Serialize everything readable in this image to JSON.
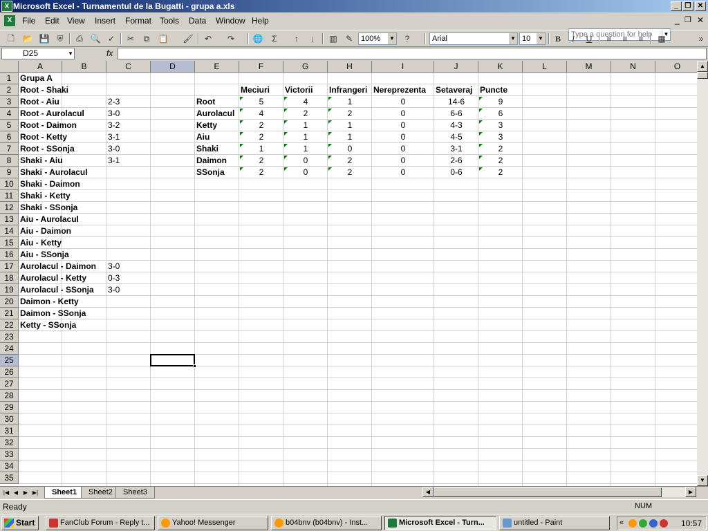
{
  "window": {
    "title": "Microsoft Excel - Turnamentul de la Bugatti - grupa a.xls"
  },
  "menu": [
    "File",
    "Edit",
    "View",
    "Insert",
    "Format",
    "Tools",
    "Data",
    "Window",
    "Help"
  ],
  "help_placeholder": "Type a question for help",
  "toolbar": {
    "zoom": "100%",
    "font": "Arial",
    "size": "10"
  },
  "name_box": "D25",
  "fx_symbol": "fx",
  "columns": [
    "A",
    "B",
    "C",
    "D",
    "E",
    "F",
    "G",
    "H",
    "I",
    "J",
    "K",
    "L",
    "M",
    "N",
    "O"
  ],
  "rows": [
    "1",
    "2",
    "3",
    "4",
    "5",
    "6",
    "7",
    "8",
    "9",
    "10",
    "11",
    "12",
    "13",
    "14",
    "15",
    "16",
    "17",
    "18",
    "19",
    "20",
    "21",
    "22",
    "23",
    "24",
    "25",
    "26",
    "27",
    "28",
    "29",
    "30",
    "31",
    "32",
    "33",
    "34",
    "35"
  ],
  "matches": [
    "Grupa A",
    "Root - Shaki",
    "Root - Aiu",
    "Root - Aurolacul",
    "Root - Daimon",
    "Root - Ketty",
    "Root - SSonja",
    "Shaki - Aiu",
    "Shaki - Aurolacul",
    "Shaki - Daimon",
    "Shaki - Ketty",
    "Shaki - SSonja",
    "Aiu - Aurolacul",
    "Aiu - Daimon",
    "Aiu - Ketty",
    "Aiu - SSonja",
    "Aurolacul - Daimon",
    "Aurolacul - Ketty",
    "Aurolacul - SSonja",
    "Daimon - Ketty",
    "Daimon - SSonja",
    "Ketty - SSonja"
  ],
  "scores": [
    "",
    "",
    "2-3",
    "3-0",
    "3-2",
    "3-1",
    "3-0",
    "3-1",
    "",
    "",
    "",
    "",
    "",
    "",
    "",
    "",
    "3-0",
    "0-3",
    "3-0",
    "",
    "",
    ""
  ],
  "standings": {
    "headers": [
      "Meciuri",
      "Victorii",
      "Infrangeri",
      "Nereprezenta",
      "Setaveraj",
      "Puncte"
    ],
    "teams": [
      {
        "name": "Root",
        "values": [
          "5",
          "4",
          "1",
          "0",
          "14-6",
          "9"
        ]
      },
      {
        "name": "Aurolacul",
        "values": [
          "4",
          "2",
          "2",
          "0",
          "6-6",
          "6"
        ]
      },
      {
        "name": "Ketty",
        "values": [
          "2",
          "1",
          "1",
          "0",
          "4-3",
          "3"
        ]
      },
      {
        "name": "Aiu",
        "values": [
          "2",
          "1",
          "1",
          "0",
          "4-5",
          "3"
        ]
      },
      {
        "name": "Shaki",
        "values": [
          "1",
          "1",
          "0",
          "0",
          "3-1",
          "2"
        ]
      },
      {
        "name": "Daimon",
        "values": [
          "2",
          "0",
          "2",
          "0",
          "2-6",
          "2"
        ]
      },
      {
        "name": "SSonja",
        "values": [
          "2",
          "0",
          "2",
          "0",
          "0-6",
          "2"
        ]
      }
    ]
  },
  "sheets": [
    "Sheet1",
    "Sheet2",
    "Sheet3"
  ],
  "status": {
    "ready": "Ready",
    "num": "NUM"
  },
  "taskbar": {
    "start": "Start",
    "tasks": [
      "FanClub Forum - Reply t...",
      "Yahoo! Messenger",
      "b04bnv (b04bnv) - Inst...",
      "Microsoft Excel - Turn...",
      "untitled - Paint"
    ],
    "clock": "10:57"
  },
  "colors": {
    "title_start": "#0a246a",
    "title_end": "#a6caf0",
    "comment_marker": "#008000",
    "chrome": "#d4d0c8"
  }
}
